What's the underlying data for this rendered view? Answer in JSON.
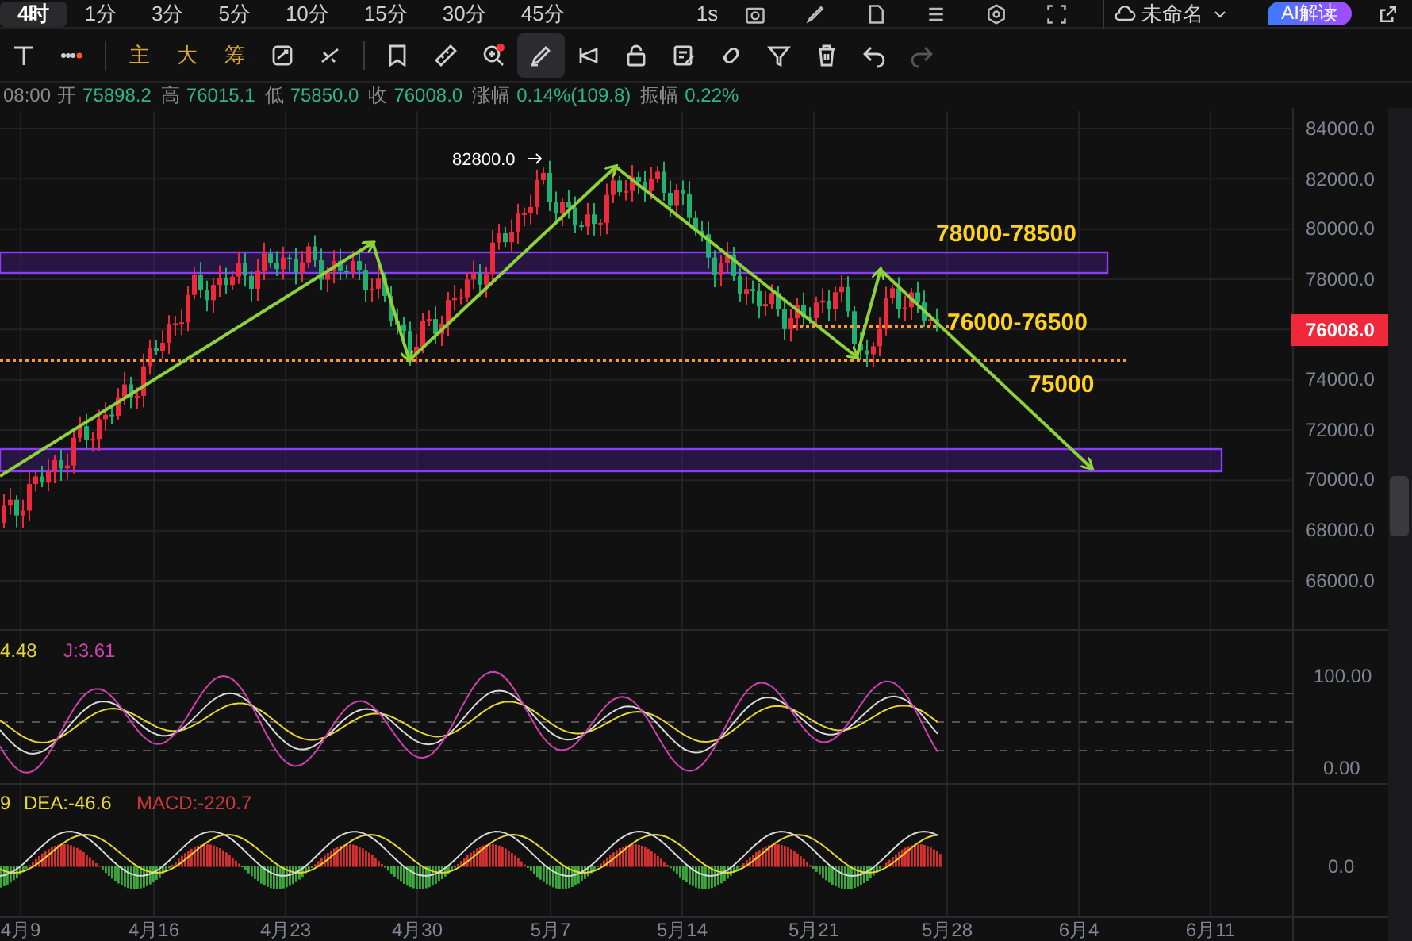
{
  "toolbar": {
    "timeframes": [
      {
        "label": "4时",
        "selected": true
      },
      {
        "label": "1分",
        "selected": false
      },
      {
        "label": "3分",
        "selected": false
      },
      {
        "label": "5分",
        "selected": false
      },
      {
        "label": "10分",
        "selected": false
      },
      {
        "label": "15分",
        "selected": false
      },
      {
        "label": "30分",
        "selected": false
      },
      {
        "label": "45分",
        "selected": false
      }
    ],
    "interval": "1s",
    "layout_name": "未命名",
    "ai_button": "AI解读"
  },
  "tools": [
    {
      "kind": "icon",
      "selected": false,
      "disabled": false
    },
    {
      "kind": "icon",
      "selected": false,
      "disabled": false
    },
    {
      "kind": "divider"
    },
    {
      "kind": "label",
      "text": "主",
      "selected": false,
      "disabled": false
    },
    {
      "kind": "label",
      "text": "大",
      "selected": false,
      "disabled": false
    },
    {
      "kind": "label",
      "text": "筹",
      "selected": false,
      "disabled": false
    },
    {
      "kind": "icon",
      "selected": false,
      "disabled": false
    },
    {
      "kind": "icon",
      "selected": false,
      "disabled": false
    },
    {
      "kind": "divider"
    },
    {
      "kind": "icon",
      "selected": false,
      "disabled": false
    },
    {
      "kind": "icon",
      "selected": false,
      "disabled": false
    },
    {
      "kind": "icon",
      "selected": false,
      "disabled": false
    },
    {
      "kind": "icon",
      "selected": true,
      "disabled": false
    },
    {
      "kind": "icon",
      "selected": false,
      "disabled": false
    },
    {
      "kind": "icon",
      "selected": false,
      "disabled": false
    },
    {
      "kind": "icon",
      "selected": false,
      "disabled": false
    },
    {
      "kind": "icon",
      "selected": false,
      "disabled": false
    },
    {
      "kind": "icon",
      "selected": false,
      "disabled": false
    },
    {
      "kind": "icon",
      "selected": false,
      "disabled": false
    },
    {
      "kind": "icon",
      "selected": false,
      "disabled": false
    },
    {
      "kind": "icon",
      "selected": false,
      "disabled": true
    }
  ],
  "info_line": {
    "time": "08:00",
    "fields": [
      {
        "label": "开",
        "value": "75898.2"
      },
      {
        "label": "高",
        "value": "76015.1"
      },
      {
        "label": "低",
        "value": "75850.0"
      },
      {
        "label": "收",
        "value": "76008.0"
      },
      {
        "label": "涨幅",
        "value": "0.14%(109.8)"
      },
      {
        "label": "振幅",
        "value": "0.22%"
      }
    ]
  },
  "price_axis": {
    "ticks": [
      "84000.0",
      "82000.0",
      "80000.0",
      "78000.0",
      "74000.0",
      "72000.0",
      "70000.0",
      "68000.0",
      "66000.0"
    ],
    "last_price": "76008.0"
  },
  "annotations": {
    "high_marker": "82800.0",
    "zones": [
      "78000-78500",
      "76000-76500",
      "75000"
    ]
  },
  "kdj": {
    "labels": [
      {
        "text": "4.48",
        "color": "#e8d630"
      },
      {
        "text": "J:3.61",
        "color": "#d040b0"
      }
    ],
    "axis": [
      "100.00",
      "0.00"
    ]
  },
  "macd": {
    "labels": [
      {
        "text": "9",
        "color": "#e8d630"
      },
      {
        "text": "DEA:-46.6",
        "color": "#e8d630"
      },
      {
        "text": "MACD:-220.7",
        "color": "#d03838"
      }
    ],
    "axis": [
      "0.0"
    ]
  },
  "date_axis": [
    "4月9",
    "4月16",
    "4月23",
    "4月30",
    "5月7",
    "5月14",
    "5月21",
    "5月28",
    "6月4",
    "6月11"
  ]
}
